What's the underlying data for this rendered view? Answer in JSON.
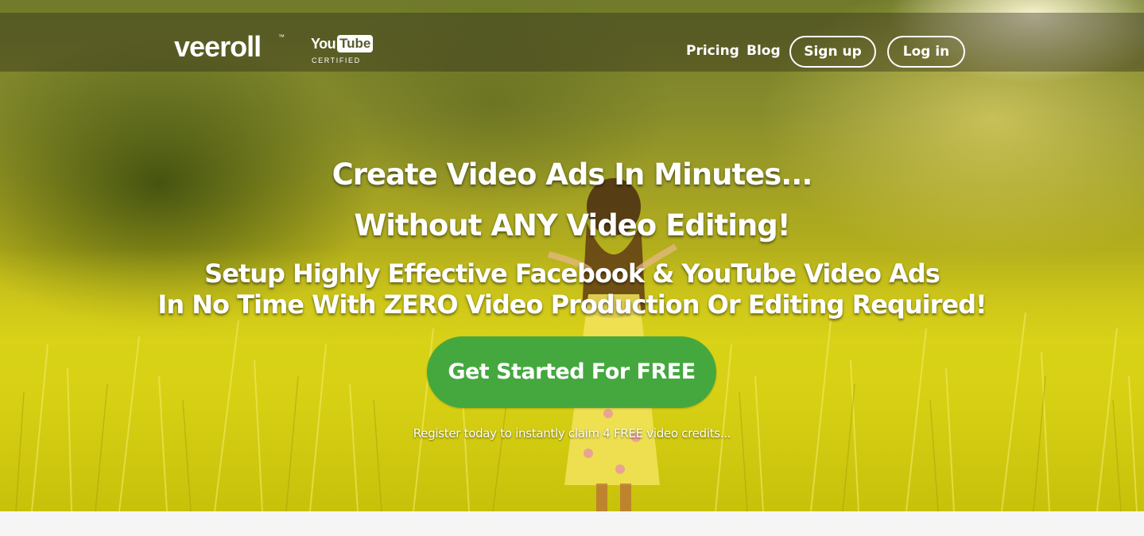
{
  "header": {
    "logo_text": "veeroll",
    "logo_tm": "™",
    "badge": {
      "you": "You",
      "tube": "Tube",
      "certified": "CERTIFIED"
    },
    "nav": {
      "pricing": "Pricing",
      "blog": "Blog",
      "signup": "Sign up",
      "login": "Log in"
    }
  },
  "hero": {
    "headline_1": "Create Video Ads In Minutes...",
    "headline_2": "Without ANY Video Editing!",
    "subhead_1": "Setup Highly Effective Facebook & YouTube Video Ads",
    "subhead_2": "In No Time With ZERO Video Production Or Editing Required!",
    "cta_label": "Get Started For FREE",
    "register_note": "Register today to instantly claim 4 FREE video credits..."
  },
  "colors": {
    "cta_green": "#45a83f",
    "text_white": "#ffffff",
    "footer_bg": "#f5f5f5"
  },
  "icons": {
    "background": "meadow-photo"
  }
}
